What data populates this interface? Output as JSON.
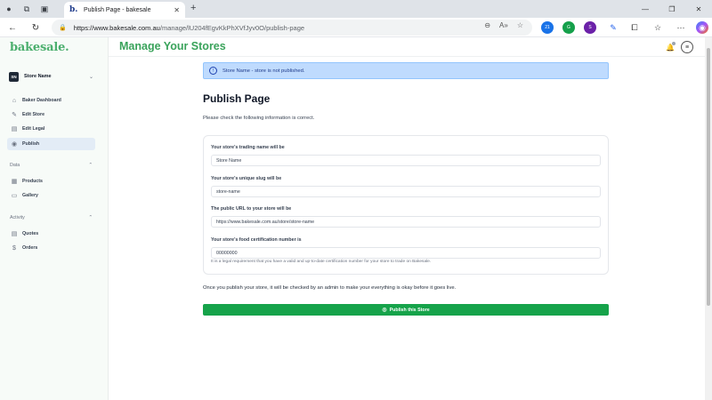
{
  "browser": {
    "tab_title": "Publish Page - bakesale",
    "tab_favicon": "b.",
    "url_host": "https://www.bakesale.com.au",
    "url_path": "/manage/lU204fEgvKkPhXVfJyv0O/publish-page",
    "extensions": [
      {
        "name": "ext-badge",
        "label": "21",
        "color": "#1a73e8"
      },
      {
        "name": "grammarly",
        "label": "G",
        "color": "#15a04b"
      },
      {
        "name": "profile-ext",
        "label": "S",
        "color": "#6b21a8"
      }
    ]
  },
  "sidebar": {
    "logo": "bakesale.",
    "store": {
      "initials": "SN",
      "name": "Store Name"
    },
    "items": [
      {
        "label": "Baker Dashboard",
        "icon": "home-icon"
      },
      {
        "label": "Edit Store",
        "icon": "edit-icon"
      },
      {
        "label": "Edit Legal",
        "icon": "legal-icon"
      },
      {
        "label": "Publish",
        "icon": "eye-icon"
      }
    ],
    "data_section": "Data",
    "data_items": [
      {
        "label": "Products",
        "icon": "box-icon"
      },
      {
        "label": "Gallery",
        "icon": "image-icon"
      }
    ],
    "activity_section": "Activity",
    "activity_items": [
      {
        "label": "Quotes",
        "icon": "document-icon"
      },
      {
        "label": "Orders",
        "icon": "dollar-icon"
      }
    ]
  },
  "main": {
    "title": "Manage Your Stores",
    "notification_count": "0",
    "alert": "Store Name - store is not published.",
    "heading": "Publish Page",
    "intro": "Please check the following information is correct.",
    "fields": [
      {
        "label": "Your store's trading name will be",
        "value": "Store Name"
      },
      {
        "label": "Your store's unique slug will be",
        "value": "store-name"
      },
      {
        "label": "The public URL to your store will be",
        "value": "https://www.bakesale.com.au/store/store-name"
      },
      {
        "label": "Your store's food certification number is",
        "value": "00000000"
      }
    ],
    "help_text": "It is a legal requirement that you have a valid and up-to-date certification number for your store to trade on Bakesale.",
    "note": "Once you publish your store, it will be checked by an admin to make your everything is okay before it goes live.",
    "publish_button": "Publish this Store"
  }
}
